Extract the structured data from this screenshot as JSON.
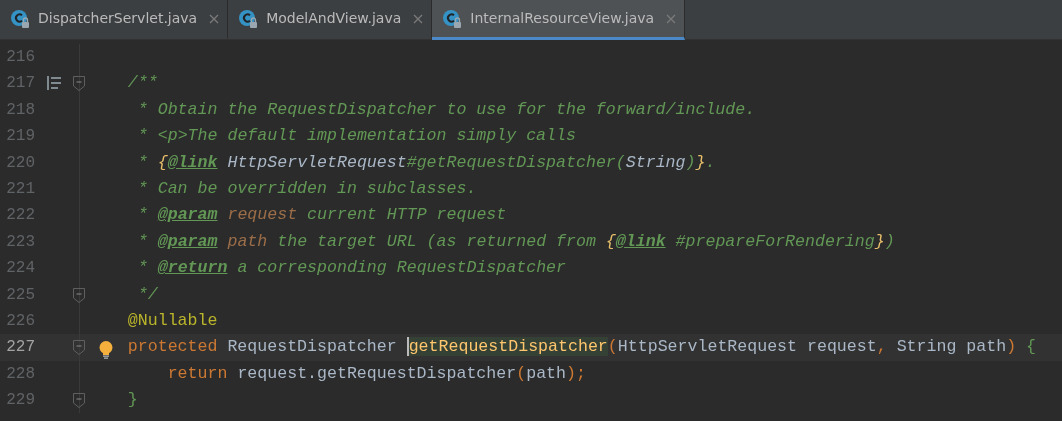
{
  "tabs": [
    {
      "label": "DispatcherServlet.java",
      "selected": false,
      "locked": true
    },
    {
      "label": "ModelAndView.java",
      "selected": false,
      "locked": true
    },
    {
      "label": "InternalResourceView.java",
      "selected": true,
      "locked": true
    }
  ],
  "lines": [
    {
      "number": "216",
      "current": false
    },
    {
      "number": "217",
      "current": false,
      "rendered_doc_toggle": true,
      "fold_marker": true,
      "tokens": [
        {
          "text": "    /**",
          "kind": "comment"
        }
      ]
    },
    {
      "number": "218",
      "current": false,
      "tokens": [
        {
          "text": "     * Obtain the RequestDispatcher to use for the forward/include.",
          "kind": "comment"
        }
      ]
    },
    {
      "number": "219",
      "current": false,
      "tokens": [
        {
          "text": "     * ",
          "kind": "comment"
        },
        {
          "text": "<p>",
          "kind": "markup"
        },
        {
          "text": "The default implementation simply calls",
          "kind": "comment"
        }
      ]
    },
    {
      "number": "220",
      "current": false,
      "tokens": [
        {
          "text": "     * ",
          "kind": "comment"
        },
        {
          "text": "{",
          "kind": "brace"
        },
        {
          "text": "@link",
          "kind": "tag"
        },
        {
          "text": " HttpServletRequest",
          "kind": "ref"
        },
        {
          "text": "#getRequestDispatcher(",
          "kind": "comment"
        },
        {
          "text": "String",
          "kind": "ref"
        },
        {
          "text": ")",
          "kind": "comment"
        },
        {
          "text": "}",
          "kind": "brace"
        },
        {
          "text": ".",
          "kind": "comment"
        }
      ]
    },
    {
      "number": "221",
      "current": false,
      "tokens": [
        {
          "text": "     * Can be overridden in subclasses.",
          "kind": "comment"
        }
      ]
    },
    {
      "number": "222",
      "current": false,
      "tokens": [
        {
          "text": "     * ",
          "kind": "comment"
        },
        {
          "text": "@param",
          "kind": "tag"
        },
        {
          "text": " request",
          "kind": "param"
        },
        {
          "text": " current HTTP request",
          "kind": "comment"
        }
      ]
    },
    {
      "number": "223",
      "current": false,
      "tokens": [
        {
          "text": "     * ",
          "kind": "comment"
        },
        {
          "text": "@param",
          "kind": "tag"
        },
        {
          "text": " path",
          "kind": "param"
        },
        {
          "text": " the target URL (as returned from ",
          "kind": "comment"
        },
        {
          "text": "{",
          "kind": "brace"
        },
        {
          "text": "@link",
          "kind": "tag"
        },
        {
          "text": " #prepareForRendering",
          "kind": "comment"
        },
        {
          "text": "}",
          "kind": "brace"
        },
        {
          "text": ")",
          "kind": "comment"
        }
      ]
    },
    {
      "number": "224",
      "current": false,
      "tokens": [
        {
          "text": "     * ",
          "kind": "comment"
        },
        {
          "text": "@return",
          "kind": "tag"
        },
        {
          "text": " a corresponding RequestDispatcher",
          "kind": "comment"
        }
      ]
    },
    {
      "number": "225",
      "current": false,
      "fold_marker": true,
      "tokens": [
        {
          "text": "     */",
          "kind": "comment"
        }
      ]
    },
    {
      "number": "226",
      "current": false,
      "tokens": [
        {
          "text": "    @Nullable",
          "kind": "annotation"
        }
      ]
    },
    {
      "number": "227",
      "current": true,
      "fold_marker": true,
      "intention_bulb": true,
      "tokens": [
        {
          "text": "    protected",
          "kind": "keyword"
        },
        {
          "text": " RequestDispatcher ",
          "kind": "plain"
        },
        {
          "text": "getRequestDispatcher",
          "kind": "method",
          "highlighted": true,
          "caret": true
        },
        {
          "text": "(",
          "kind": "punct"
        },
        {
          "text": "HttpServletRequest request",
          "kind": "plain"
        },
        {
          "text": ", ",
          "kind": "punct"
        },
        {
          "text": "String path",
          "kind": "plain"
        },
        {
          "text": ") ",
          "kind": "punct"
        },
        {
          "text": "{",
          "kind": "block"
        }
      ]
    },
    {
      "number": "228",
      "current": false,
      "tokens": [
        {
          "text": "        return",
          "kind": "keyword"
        },
        {
          "text": " request.getRequestDispatcher",
          "kind": "plain"
        },
        {
          "text": "(",
          "kind": "punct"
        },
        {
          "text": "path",
          "kind": "plain"
        },
        {
          "text": ");",
          "kind": "punct"
        }
      ]
    },
    {
      "number": "229",
      "current": false,
      "fold_marker": true,
      "tokens": [
        {
          "text": "    }",
          "kind": "block"
        }
      ]
    }
  ]
}
